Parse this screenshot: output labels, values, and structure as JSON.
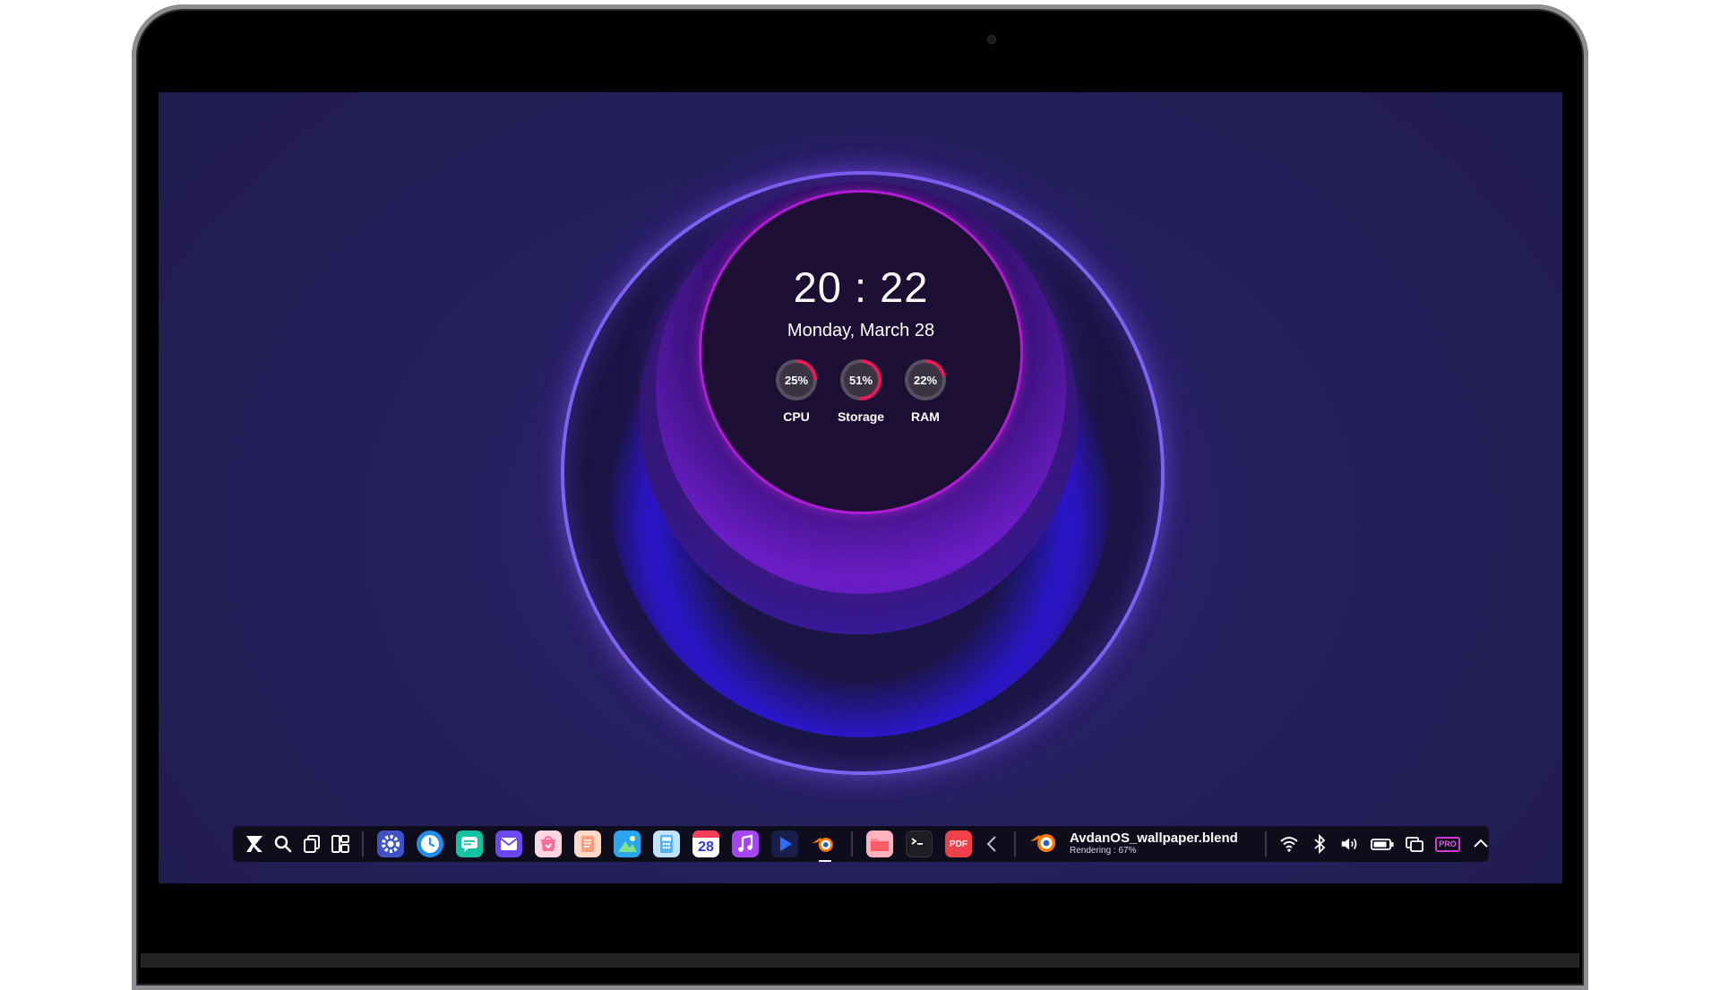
{
  "desktop": {
    "time": "20 : 22",
    "date": "Monday, March 28",
    "gauges": [
      {
        "label": "CPU",
        "value_text": "25%",
        "percent": 25
      },
      {
        "label": "Storage",
        "value_text": "51%",
        "percent": 51
      },
      {
        "label": "RAM",
        "value_text": "22%",
        "percent": 22
      }
    ],
    "colors": {
      "accent": "#b21bd6",
      "gauge": "#e8185a",
      "ring": "#7e63f2"
    }
  },
  "taskbar": {
    "left_icons": [
      "avdan-logo-icon",
      "search-icon",
      "window-switcher-icon",
      "widgets-icon"
    ],
    "apps": [
      {
        "name": "settings-icon",
        "color": "#3f53c7"
      },
      {
        "name": "clock-icon",
        "color": "#1f8ef0"
      },
      {
        "name": "messages-icon",
        "color": "#12c3a1"
      },
      {
        "name": "mail-icon",
        "color": "#6b48f0"
      },
      {
        "name": "store-icon",
        "color": "#ff6b9a"
      },
      {
        "name": "notes-icon",
        "color": "#ff9d7a"
      },
      {
        "name": "photos-icon",
        "color": "#2aa6f0"
      },
      {
        "name": "calculator-icon",
        "color": "#4fb4f0"
      },
      {
        "name": "calendar-icon",
        "color": "#ffffff",
        "text": "28"
      },
      {
        "name": "music-icon",
        "color": "#a546f0"
      },
      {
        "name": "media-player-icon",
        "color": "#1a1e4a"
      },
      {
        "name": "blender-icon",
        "color": "#ff7a00"
      }
    ],
    "pinned": [
      {
        "name": "files-icon",
        "color": "#ff5c6a"
      },
      {
        "name": "terminal-icon",
        "color": "#1d1d24"
      },
      {
        "name": "pdf-icon",
        "color": "#f0404a",
        "text": "PDF"
      }
    ],
    "running_task": {
      "title": "AvdanOS_wallpaper.blend",
      "status_label": "Rendering :",
      "progress_text": "67%",
      "progress": 67
    },
    "tray": {
      "icons": [
        "wifi-icon",
        "bluetooth-icon",
        "volume-icon",
        "battery-icon",
        "multitask-icon"
      ],
      "pro_badge": "PRO",
      "expand_icon": "chevron-up-icon"
    }
  }
}
